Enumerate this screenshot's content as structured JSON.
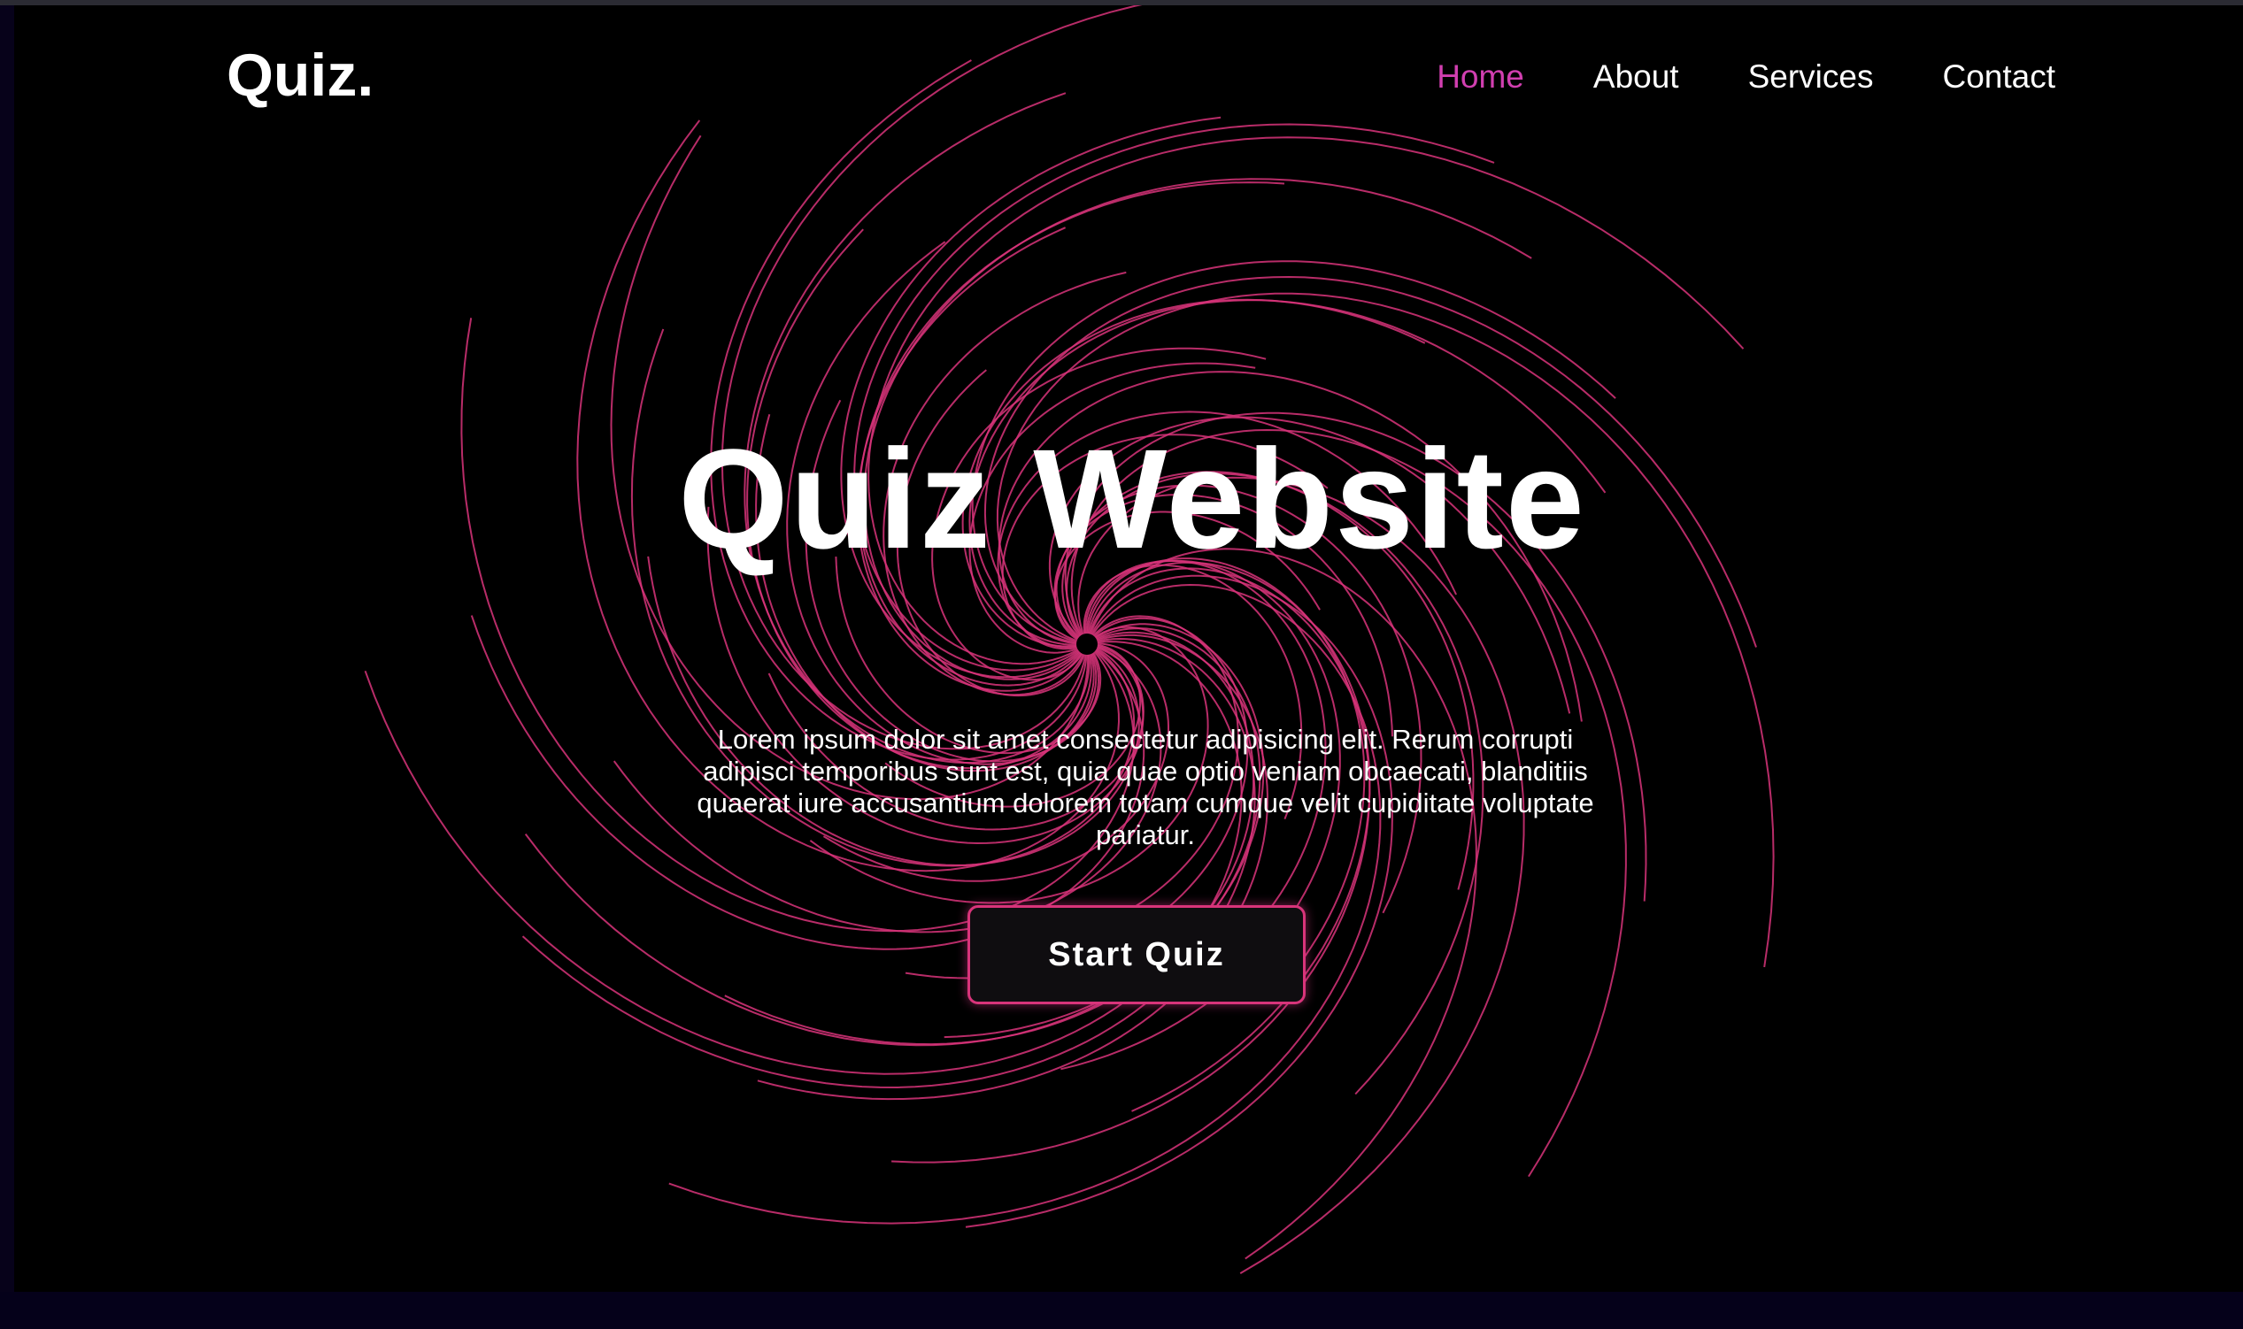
{
  "header": {
    "logo": "Quiz.",
    "nav": [
      {
        "label": "Home",
        "active": true
      },
      {
        "label": "About",
        "active": false
      },
      {
        "label": "Services",
        "active": false
      },
      {
        "label": "Contact",
        "active": false
      }
    ]
  },
  "hero": {
    "title": "Quiz Website",
    "description": "Lorem ipsum dolor sit amet consectetur adipisicing elit. Rerum corrupti adipisci temporibus sunt est, quia quae optio veniam obcaecati, blanditiis quaerat iure accusantium dolorem totam cumque velit cupiditate voluptate pariatur.",
    "cta_label": "Start Quiz"
  },
  "colors": {
    "background": "#000000",
    "accent": "#d13fb0",
    "spiral": "#d8347a",
    "text": "#ffffff"
  }
}
